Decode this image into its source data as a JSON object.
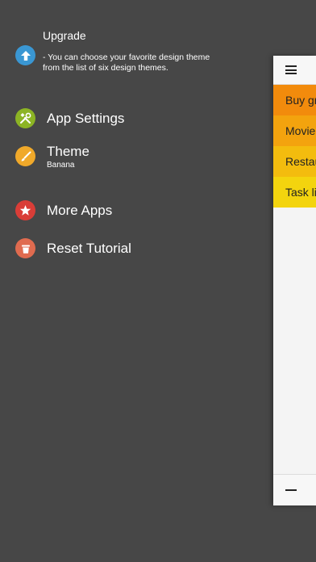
{
  "menu": {
    "upgrade": {
      "title": "Upgrade",
      "description": "- You can choose your favorite design theme from the list of six design themes.",
      "icon": "arrow-up-icon",
      "color": "#3a97d3"
    },
    "settings": {
      "label": "App Settings",
      "icon": "tools-icon",
      "color": "#8cb424"
    },
    "theme": {
      "label": "Theme",
      "value": "Banana",
      "icon": "brush-icon",
      "color": "#f0a92a"
    },
    "more_apps": {
      "label": "More Apps",
      "icon": "star-icon",
      "color": "#d93d37"
    },
    "reset": {
      "label": "Reset Tutorial",
      "icon": "trash-icon",
      "color": "#e06b4f"
    }
  },
  "main_panel": {
    "lists": [
      {
        "label": "Buy gr",
        "color": "#f28b0c"
      },
      {
        "label": "Movie",
        "color": "#f3a30e"
      },
      {
        "label": "Restau",
        "color": "#f3bc0e"
      },
      {
        "label": "Task li",
        "color": "#f3d40e"
      }
    ]
  }
}
